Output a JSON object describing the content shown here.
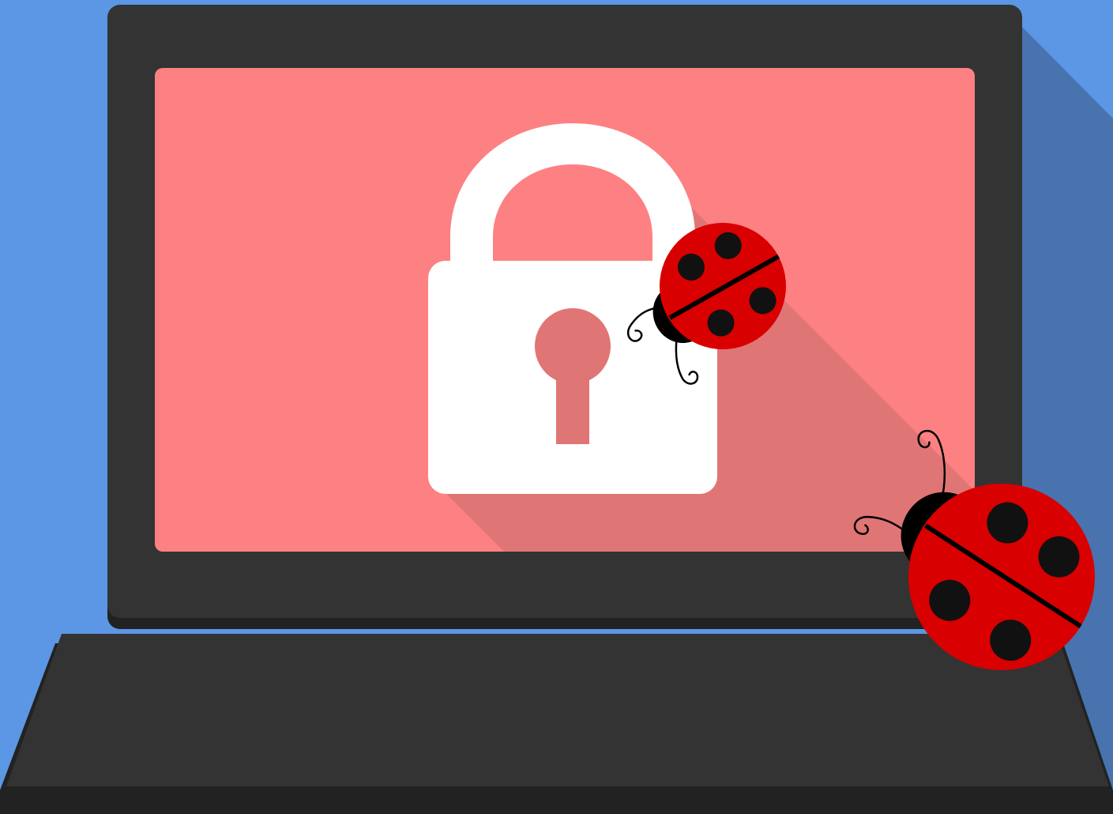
{
  "illustration": {
    "subject": "laptop-with-padlock-and-ladybugs",
    "icons": [
      "laptop-icon",
      "padlock-icon",
      "keyhole-icon",
      "ladybug-icon"
    ],
    "ladybug_count": 2
  },
  "colors": {
    "background": "#5b97e4",
    "background_shadow": "#4873ae",
    "laptop_body": "#333333",
    "laptop_edge": "#222222",
    "screen": "#fd8182",
    "screen_shadow": "#e07576",
    "padlock": "#ffffff",
    "padlock_shade": "#eeeeee",
    "ladybug_shell": "#d80000",
    "ladybug_spots": "#111111",
    "ladybug_head": "#000000"
  }
}
